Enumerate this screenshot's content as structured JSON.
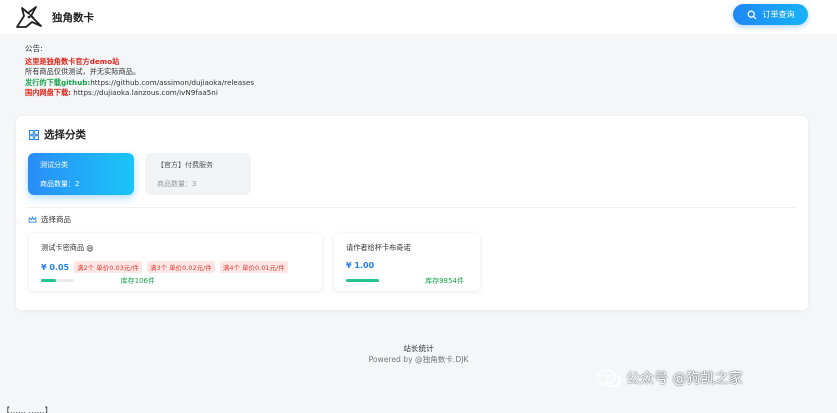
{
  "header": {
    "site_title": "独角数卡",
    "order_button_label": "订单查询",
    "icons": {
      "logo": "unicorn-logo",
      "order": "search-icon"
    },
    "colors": {
      "accent": "#1e88f5"
    }
  },
  "notice": {
    "title": "公告:",
    "line1": "这里是独角数卡官方demo站",
    "line2": "所有商品仅供测试，并无实际商品。",
    "line3_label": "发行的下载github:",
    "line3_value": "https://github.com/assimon/dujiaoka/releases",
    "line4_label": "国内网盘下载:",
    "line4_value": "https://dujiaoka.lanzous.com/ivN9faa5ni"
  },
  "category": {
    "heading": "选择分类",
    "items": [
      {
        "name": "测试分类",
        "count": "商品数量：2",
        "active": true
      },
      {
        "name": "【官方】付费服务",
        "count": "商品数量：3",
        "active": false
      }
    ]
  },
  "goods_section": {
    "heading": "选择商品",
    "items": [
      {
        "name": "测试卡密商品",
        "emoji": "😄",
        "price": "¥ 0.05",
        "tags": [
          "满2个 单价0.03元/件",
          "满3个 单价0.02元/件",
          "满4个 单价0.01元/件"
        ],
        "stock": "库存106件",
        "stock_ratio": 0.45
      },
      {
        "name": "请作者给杯卡布奇诺",
        "emoji": "",
        "price": "¥ 1.00",
        "tags": [],
        "stock": "库存9854件",
        "stock_ratio": 1.0
      }
    ]
  },
  "footer": {
    "line1": "站长统计",
    "line2": "Powered by @独角数卡.DJK"
  },
  "watermark": {
    "text": "公众号 @狗凯之家",
    "icon": "wechat-icon"
  },
  "clipped_text": "【……  ……】"
}
